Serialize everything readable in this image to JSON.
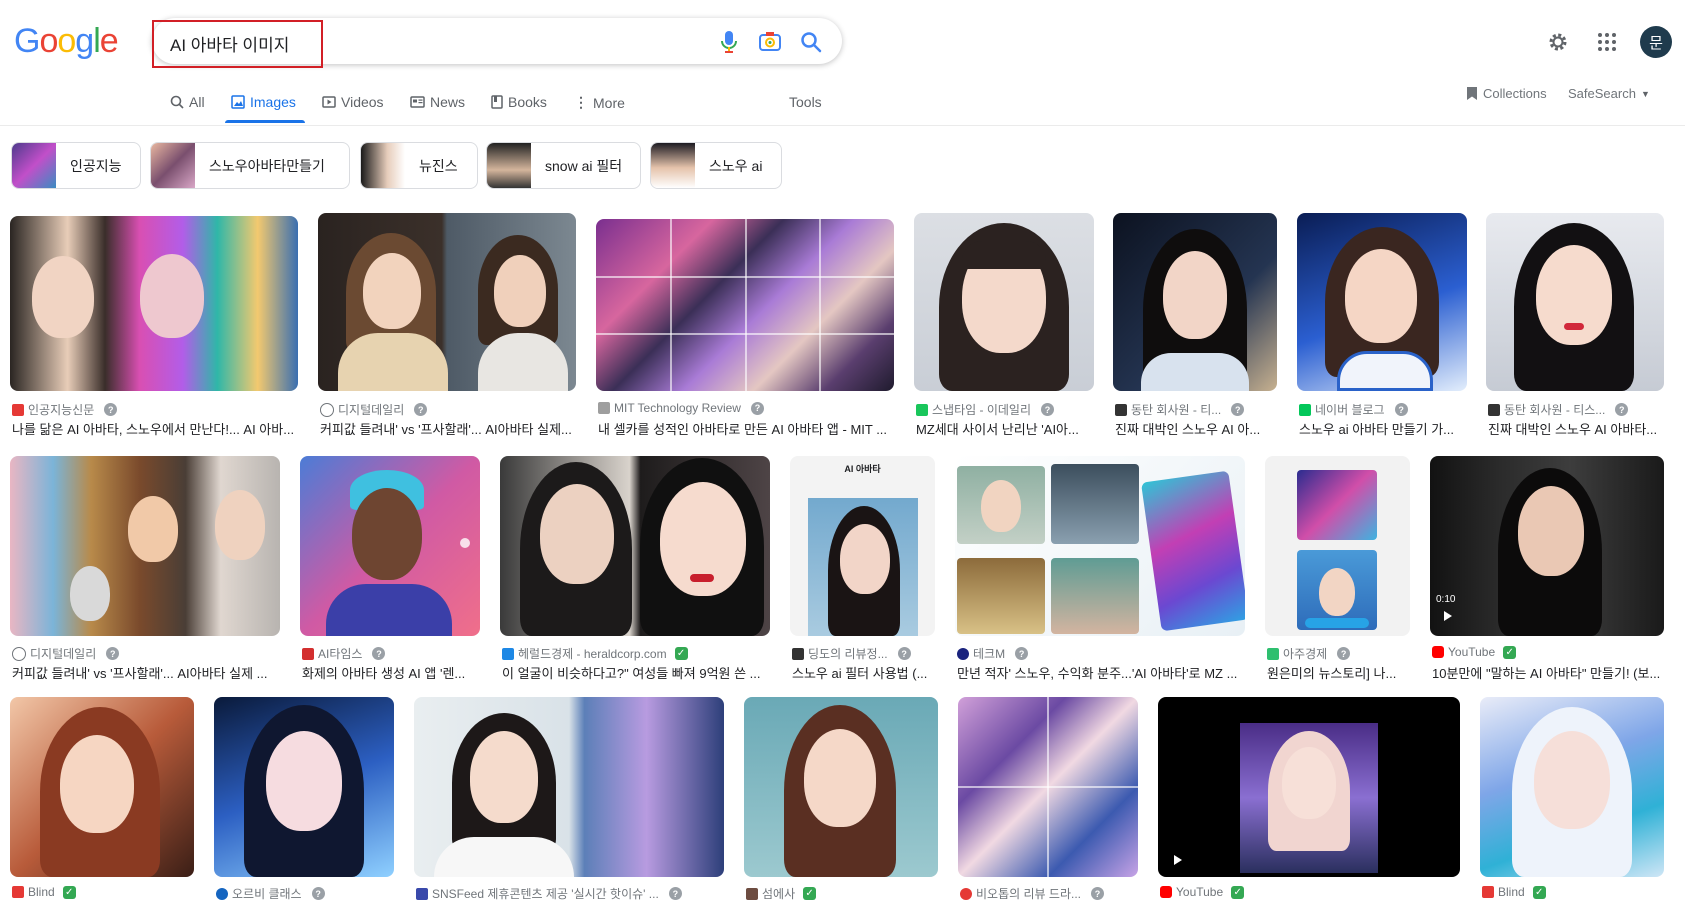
{
  "search": {
    "query": "AI 아바타 이미지"
  },
  "logo": [
    "G",
    "o",
    "o",
    "g",
    "l",
    "e"
  ],
  "user": {
    "avatar_initial": "문"
  },
  "tabs": [
    {
      "label": "All"
    },
    {
      "label": "Images"
    },
    {
      "label": "Videos"
    },
    {
      "label": "News"
    },
    {
      "label": "Books"
    },
    {
      "label": "More"
    }
  ],
  "tools_label": "Tools",
  "collections_label": "Collections",
  "safesearch_label": "SafeSearch",
  "chips": [
    {
      "label": "인공지능"
    },
    {
      "label": "스노우아바타만들기"
    },
    {
      "label": "뉴진스"
    },
    {
      "label": "snow ai 필터"
    },
    {
      "label": "스노우 ai"
    }
  ],
  "row1": [
    {
      "source": "인공지능신문",
      "title": "나를 닮은 AI 아바타, 스노우에서 만난다!... AI 아바...",
      "verified": false
    },
    {
      "source": "디지털데일리",
      "title": "커피값 들려내' vs '프사할래'... AI아바타 실제...",
      "verified": false
    },
    {
      "source": "MIT Technology Review",
      "title": "내 셀카를 성적인 아바타로 만든 AI 아바타 앱 - MIT ...",
      "verified": false
    },
    {
      "source": "스냅타임 - 이데일리",
      "title": "MZ세대 사이서 난리난 'AI아...",
      "verified": false
    },
    {
      "source": "동탄 회사원 - 티...",
      "title": "진짜 대박인 스노우 AI 아...",
      "verified": false
    },
    {
      "source": "네이버 블로그",
      "title": "스노우 ai 아바타 만들기 가...",
      "verified": false
    },
    {
      "source": "동탄 회사원 - 티스...",
      "title": "진짜 대박인 스노우 AI 아바타...",
      "verified": false
    }
  ],
  "row2": [
    {
      "source": "디지털데일리",
      "title": "커피값 들려내' vs '프사할래'... AI아바타 실제 ...",
      "verified": false
    },
    {
      "source": "AI타임스",
      "title": "화제의 아바타 생성 AI 앱 '렌...",
      "verified": false
    },
    {
      "source": "헤럴드경제 - heraldcorp.com",
      "title": "이 얼굴이 비슷하다고?\" 여성들 빠져 9억원 쓴 ...",
      "verified": true
    },
    {
      "source": "딩도의 리뷰정...",
      "title": "스노우 ai 필터 사용법 (...",
      "verified": false
    },
    {
      "source": "테크M",
      "title": "만년 적자' 스노우, 수익화 분주...'AI 아바타'로 MZ ...",
      "verified": false
    },
    {
      "source": "아주경제",
      "title": "원은미의 뉴스토리] 나...",
      "verified": false
    },
    {
      "source": "YouTube",
      "title": "10분만에 \"말하는 AI 아바타\" 만들기! (보...",
      "verified": true
    }
  ],
  "row2_overlay": {
    "ai_avatar_label": "AI 아바타",
    "video_duration": "0:10"
  },
  "row3": [
    {
      "source": "Blind",
      "verified": true
    },
    {
      "source": "오르비 클래스",
      "verified": false
    },
    {
      "source": "SNSFeed 제휴콘텐츠 제공 '실시간 핫이슈' ...",
      "verified": false
    },
    {
      "source": "섬에사",
      "verified": true
    },
    {
      "source": "비오톱의 리뷰 드라...",
      "verified": false
    },
    {
      "source": "YouTube",
      "verified": true
    },
    {
      "source": "Blind",
      "verified": true
    }
  ],
  "colors": {
    "accent": "#1a73e8",
    "highlight_border": "#d21f26",
    "logo": [
      "#4285f4",
      "#ea4335",
      "#fbbc05",
      "#4285f4",
      "#34a853",
      "#ea4335"
    ]
  }
}
